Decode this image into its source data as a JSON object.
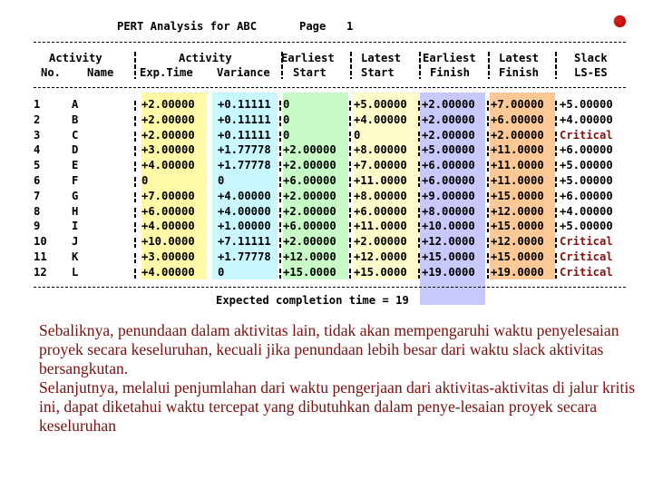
{
  "report": {
    "title": "PERT Analysis for ABC",
    "page_label": "Page",
    "page_number": "1",
    "record_indicator_icon": "red-dot-icon"
  },
  "table": {
    "header_row1": [
      "Activity",
      "Activity",
      "Earliest",
      "Latest",
      "Earliest",
      "Latest",
      "Slack"
    ],
    "header_row2": [
      "No.",
      "Name",
      "Exp.Time",
      "Variance",
      "Start",
      "Start",
      "Finish",
      "Finish",
      "LS-ES"
    ],
    "column_colors": {
      "exp_time": "#fff9a8",
      "variance": "#c8f7ff",
      "earliest_start": "#c8fac8",
      "latest_start": "#fffccc",
      "earliest_finish": "#c8c8fa",
      "latest_finish": "#fbc896"
    },
    "rows": [
      {
        "no": "1",
        "name": "A",
        "exp_time": "+2.00000",
        "variance": "+0.11111",
        "es": "0",
        "ls": "+5.00000",
        "ef": "+2.00000",
        "lf": "+7.00000",
        "slack": "+5.00000"
      },
      {
        "no": "2",
        "name": "B",
        "exp_time": "+2.00000",
        "variance": "+0.11111",
        "es": "0",
        "ls": "+4.00000",
        "ef": "+2.00000",
        "lf": "+6.00000",
        "slack": "+4.00000"
      },
      {
        "no": "3",
        "name": "C",
        "exp_time": "+2.00000",
        "variance": "+0.11111",
        "es": "0",
        "ls": "0",
        "ef": "+2.00000",
        "lf": "+2.00000",
        "slack": "Critical"
      },
      {
        "no": "4",
        "name": "D",
        "exp_time": "+3.00000",
        "variance": "+1.77778",
        "es": "+2.00000",
        "ls": "+8.00000",
        "ef": "+5.00000",
        "lf": "+11.0000",
        "slack": "+6.00000"
      },
      {
        "no": "5",
        "name": "E",
        "exp_time": "+4.00000",
        "variance": "+1.77778",
        "es": "+2.00000",
        "ls": "+7.00000",
        "ef": "+6.00000",
        "lf": "+11.0000",
        "slack": "+5.00000"
      },
      {
        "no": "6",
        "name": "F",
        "exp_time": "0",
        "variance": "0",
        "es": "+6.00000",
        "ls": "+11.0000",
        "ef": "+6.00000",
        "lf": "+11.0000",
        "slack": "+5.00000"
      },
      {
        "no": "7",
        "name": "G",
        "exp_time": "+7.00000",
        "variance": "+4.00000",
        "es": "+2.00000",
        "ls": "+8.00000",
        "ef": "+9.00000",
        "lf": "+15.0000",
        "slack": "+6.00000"
      },
      {
        "no": "8",
        "name": "H",
        "exp_time": "+6.00000",
        "variance": "+4.00000",
        "es": "+2.00000",
        "ls": "+6.00000",
        "ef": "+8.00000",
        "lf": "+12.0000",
        "slack": "+4.00000"
      },
      {
        "no": "9",
        "name": "I",
        "exp_time": "+4.00000",
        "variance": "+1.00000",
        "es": "+6.00000",
        "ls": "+11.0000",
        "ef": "+10.0000",
        "lf": "+15.0000",
        "slack": "+5.00000"
      },
      {
        "no": "10",
        "name": "J",
        "exp_time": "+10.0000",
        "variance": "+7.11111",
        "es": "+2.00000",
        "ls": "+2.00000",
        "ef": "+12.0000",
        "lf": "+12.0000",
        "slack": "Critical"
      },
      {
        "no": "11",
        "name": "K",
        "exp_time": "+3.00000",
        "variance": "+1.77778",
        "es": "+12.0000",
        "ls": "+12.0000",
        "ef": "+15.0000",
        "lf": "+15.0000",
        "slack": "Critical"
      },
      {
        "no": "12",
        "name": "L",
        "exp_time": "+4.00000",
        "variance": "0",
        "es": "+15.0000",
        "ls": "+15.0000",
        "ef": "+19.0000",
        "lf": "+19.0000",
        "slack": "Critical"
      }
    ]
  },
  "completion": "Expected completion time = 19",
  "paragraphs": [
    "Sebaliknya, penundaan dalam aktivitas lain, tidak akan mempengaruhi waktu penyelesaian proyek secara keseluruhan, kecuali jika penundaan lebih besar dari waktu slack aktivitas bersangkutan.",
    "Selanjutnya, melalui penjumlahan dari waktu pengerjaan dari aktivitas-aktivitas di jalur kritis ini, dapat diketahui waktu tercepat yang dibutuhkan dalam penye-lesaian proyek secara keseluruhan"
  ]
}
